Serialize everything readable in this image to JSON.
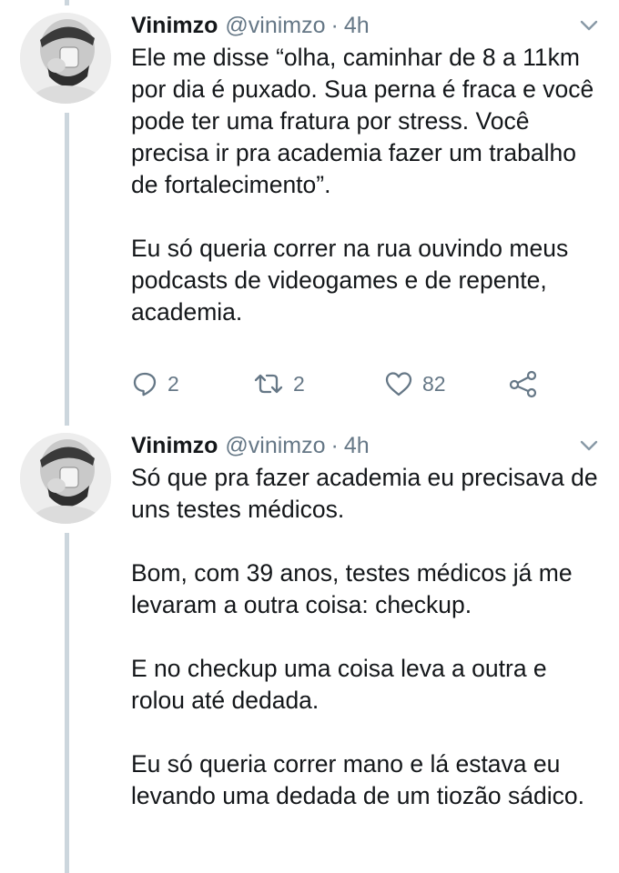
{
  "tweets": [
    {
      "name": "Vinimzo",
      "handle": "@vinimzo",
      "separator": "·",
      "time": "4h",
      "paragraphs": [
        "Ele me disse “olha, caminhar de 8 a 11km por dia é puxado. Sua perna é fraca e você pode ter uma fratura por stress. Você precisa ir pra academia fazer um trabalho de fortalecimento”.",
        "Eu só queria correr na rua ouvindo meus podcasts de videogames e de repente, academia."
      ],
      "reply_count": "2",
      "retweet_count": "2",
      "like_count": "82"
    },
    {
      "name": "Vinimzo",
      "handle": "@vinimzo",
      "separator": "·",
      "time": "4h",
      "paragraphs": [
        "Só que pra fazer academia eu precisava de uns testes médicos.",
        "Bom, com 39 anos, testes médicos já me levaram a outra coisa: checkup.",
        "E no checkup uma coisa leva a outra e rolou até dedada.",
        "Eu só queria correr mano e lá estava eu levando uma dedada de um tiozão sádico."
      ]
    }
  ],
  "colors": {
    "text": "#14171a",
    "muted": "#657786",
    "thread_line": "#ccd6dd"
  },
  "icons": [
    "reply-icon",
    "retweet-icon",
    "like-icon",
    "share-icon",
    "chevron-down-icon"
  ]
}
